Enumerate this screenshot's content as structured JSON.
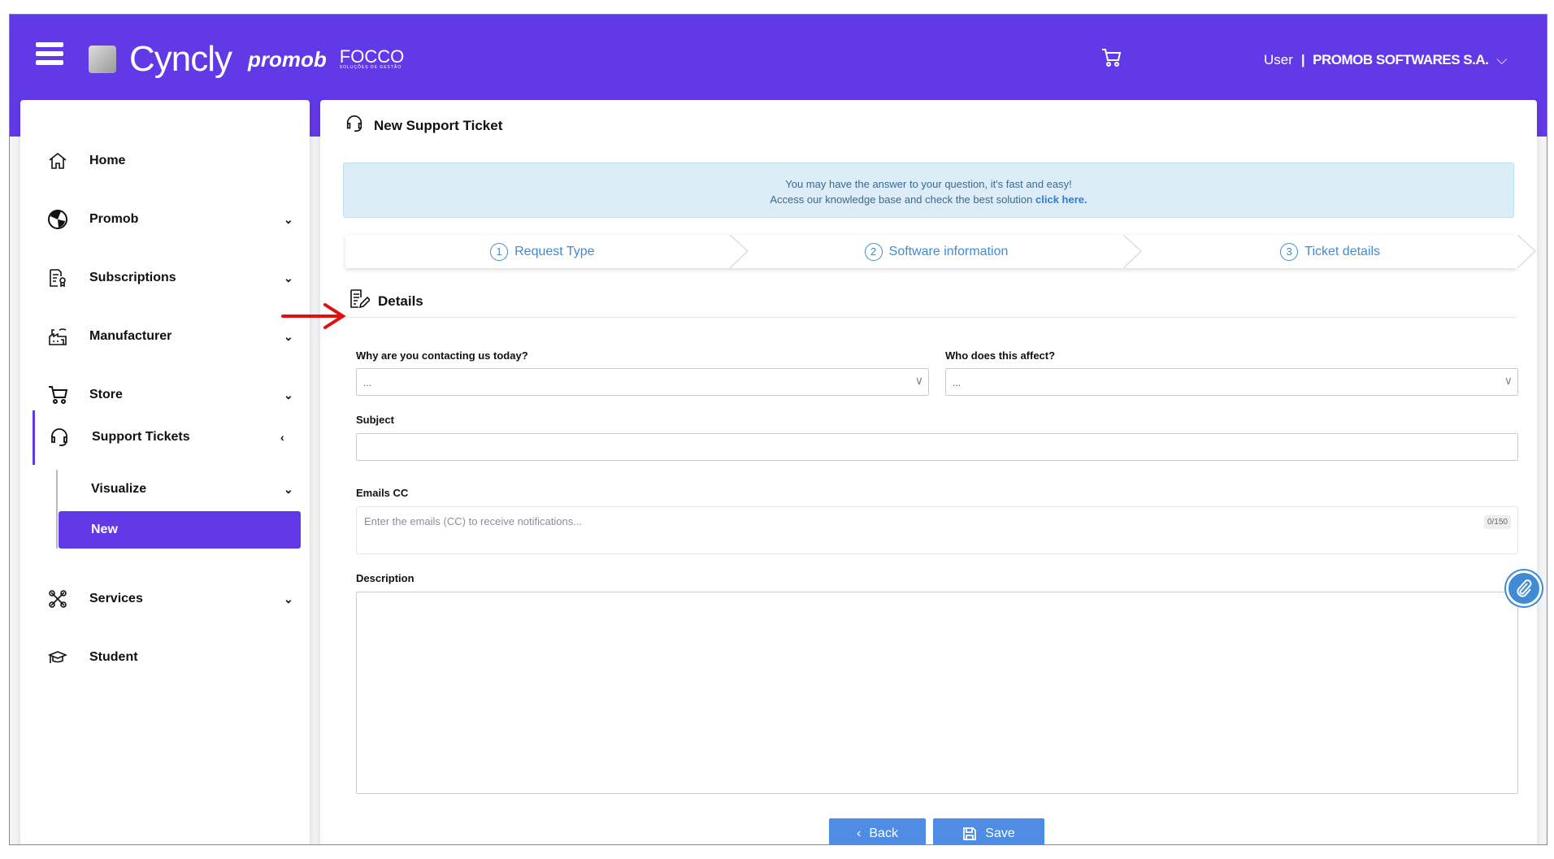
{
  "header": {
    "brand": "Cyncly",
    "brand2": "promob",
    "brand3": "FOCCO",
    "brand3_tagline": "SOLUÇÕES DE GESTÃO",
    "user_label": "User",
    "separator": "|",
    "company": "PROMOB SOFTWARES S.A."
  },
  "sidebar": {
    "items": [
      {
        "label": "Home",
        "icon": "home-icon"
      },
      {
        "label": "Promob",
        "icon": "promob-icon",
        "chevron": "⌄"
      },
      {
        "label": "Subscriptions",
        "icon": "subscriptions-icon",
        "chevron": "⌄"
      },
      {
        "label": "Manufacturer",
        "icon": "factory-icon",
        "chevron": "⌄"
      },
      {
        "label": "Store",
        "icon": "cart-icon",
        "chevron": "⌄"
      },
      {
        "label": "Support Tickets",
        "icon": "headset-icon",
        "chevron": "‹"
      },
      {
        "label": "Services",
        "icon": "tools-icon",
        "chevron": "⌄"
      },
      {
        "label": "Student",
        "icon": "graduation-cap-icon"
      }
    ],
    "sub_items": [
      {
        "label": "Visualize",
        "chevron": "⌄"
      },
      {
        "label": "New"
      }
    ]
  },
  "main": {
    "title": "New Support Ticket",
    "info_line1": "You may have the answer to your question, it's fast and easy!",
    "info_line2": "Access our knowledge base and check the best solution ",
    "info_link": "click here.",
    "steps": [
      {
        "num": "1",
        "label": "Request Type"
      },
      {
        "num": "2",
        "label": "Software information"
      },
      {
        "num": "3",
        "label": "Ticket details"
      }
    ],
    "section": "Details",
    "form": {
      "reason_label": "Why are you contacting us today?",
      "reason_value": "...",
      "affect_label": "Who does this affect?",
      "affect_value": "...",
      "subject_label": "Subject",
      "subject_value": "",
      "emails_label": "Emails CC",
      "emails_placeholder": "Enter the emails (CC) to receive notifications...",
      "emails_counter": "0/150",
      "description_label": "Description",
      "description_value": ""
    },
    "back": "Back",
    "save": "Save"
  },
  "colors": {
    "brand": "#6239e6",
    "accent": "#4f8de4",
    "annotation": "#e01010"
  }
}
